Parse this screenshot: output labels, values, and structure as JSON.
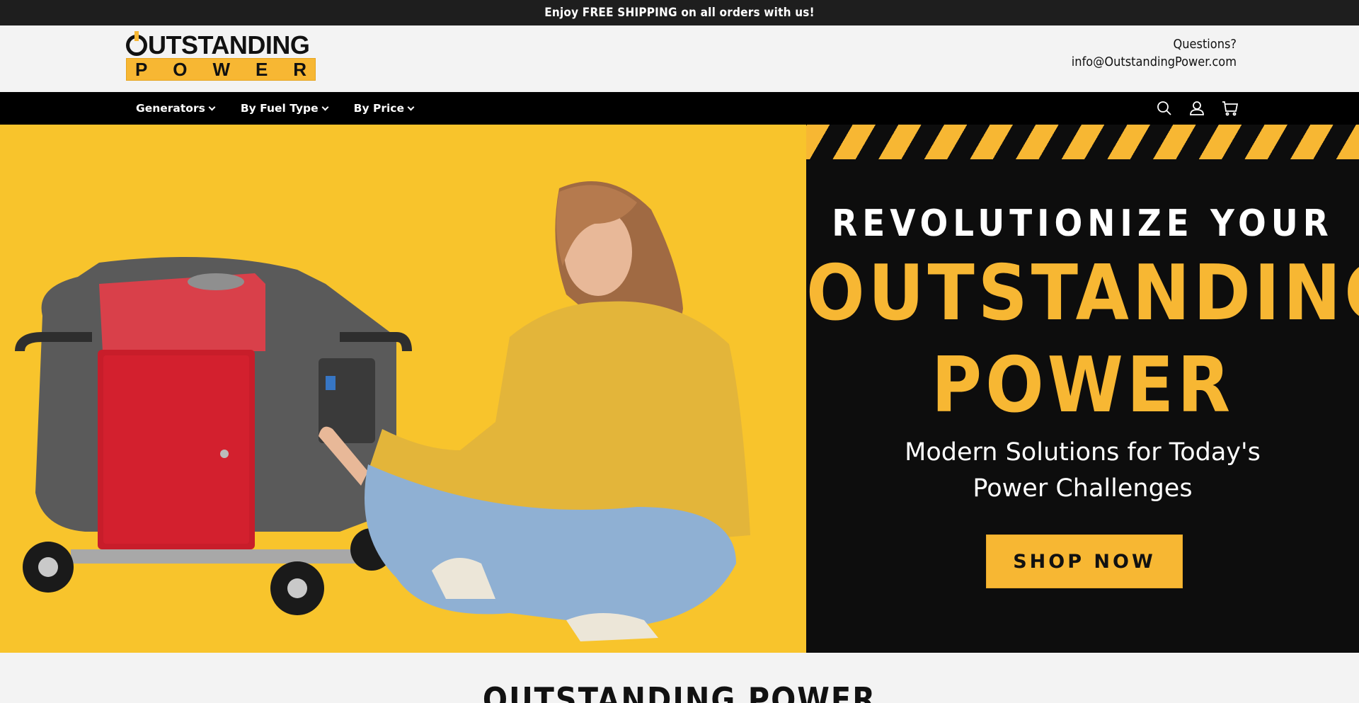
{
  "announcement": {
    "text": "Enjoy FREE SHIPPING on all orders with us!"
  },
  "header": {
    "logo": {
      "top": "UTSTANDING",
      "bottom": [
        "P",
        "O",
        "W",
        "E",
        "R"
      ]
    },
    "contact": {
      "label": "Questions?",
      "email": "info@OutstandingPower.com"
    }
  },
  "nav": {
    "items": [
      {
        "label": "Generators"
      },
      {
        "label": "By Fuel Type"
      },
      {
        "label": "By Price"
      }
    ],
    "icons": [
      "search-icon",
      "account-icon",
      "cart-icon"
    ]
  },
  "hero": {
    "line1": "REVOLUTIONIZE YOUR",
    "big1": "OUTSTANDING",
    "big2": "POWER",
    "subtitle_line1": "Modern Solutions for Today's",
    "subtitle_line2": "Power Challenges",
    "cta": "SHOP NOW",
    "colors": {
      "accent": "#f7b733",
      "dark": "#0d0d0d"
    }
  },
  "section": {
    "title": "OUTSTANDING POWER"
  }
}
